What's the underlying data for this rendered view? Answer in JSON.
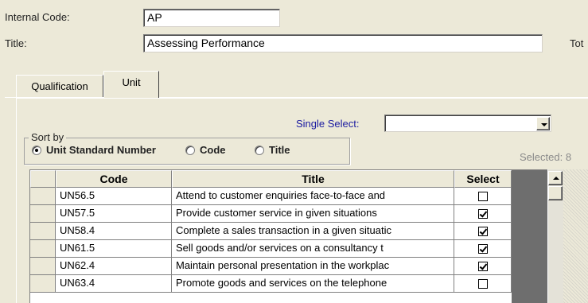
{
  "form": {
    "internal_code_label": "Internal Code:",
    "internal_code_value": "AP",
    "title_label": "Title:",
    "title_value": "Assessing Performance",
    "total_label_fragment": "Tot"
  },
  "tabs": [
    {
      "label": "Qualification",
      "active": false
    },
    {
      "label": "Unit",
      "active": true
    }
  ],
  "unit_panel": {
    "single_select_label": "Single Select:",
    "single_select_value": "",
    "sort_by_label": "Sort by",
    "sort_options": [
      {
        "label": "Unit Standard Number",
        "selected": true
      },
      {
        "label": "Code",
        "selected": false
      },
      {
        "label": "Title",
        "selected": false
      }
    ],
    "selected_count_text": "Selected: 8"
  },
  "grid": {
    "columns": [
      "Code",
      "Title",
      "Select"
    ],
    "rows": [
      {
        "code": "UN56.5",
        "title": "Attend to customer enquiries face-to-face and",
        "selected": false
      },
      {
        "code": "UN57.5",
        "title": "Provide customer service in given situations",
        "selected": true
      },
      {
        "code": "UN58.4",
        "title": "Complete a sales transaction in a given situatic",
        "selected": true
      },
      {
        "code": "UN61.5",
        "title": "Sell goods and/or services on a consultancy t",
        "selected": true
      },
      {
        "code": "UN62.4",
        "title": "Maintain personal presentation in the workplac",
        "selected": true
      },
      {
        "code": "UN63.4",
        "title": "Promote goods and services on the telephone",
        "selected": false
      }
    ]
  },
  "colors": {
    "window_bg": "#ece9d8",
    "link_blue": "#1a1aa0",
    "scroll_dark": "#6e6e6e"
  }
}
